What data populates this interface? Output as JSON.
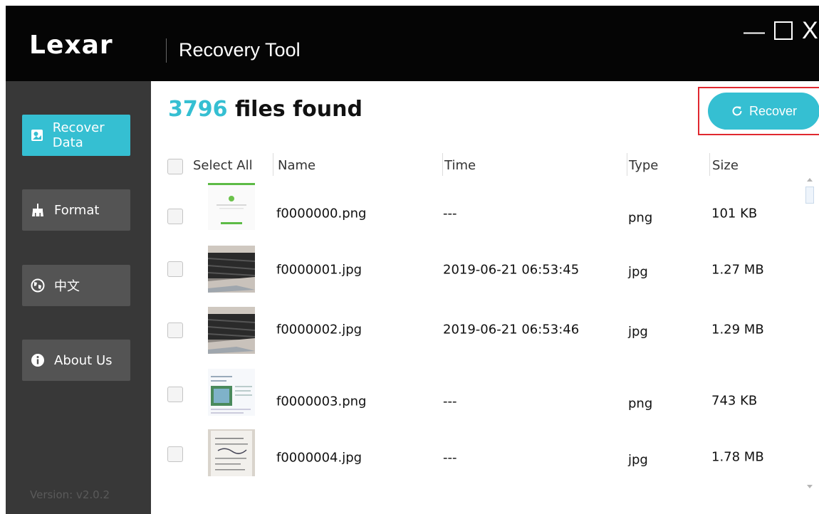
{
  "app": {
    "logo": "Lexar",
    "title": "Recovery Tool",
    "window_controls": [
      "—",
      "☐",
      "X"
    ]
  },
  "sidebar": {
    "items": [
      {
        "label": "Recover Data",
        "icon": "photo-icon",
        "active": true
      },
      {
        "label": "Format",
        "icon": "broom-icon",
        "active": false
      },
      {
        "label": "中文",
        "icon": "globe-icon",
        "active": false
      },
      {
        "label": "About Us",
        "icon": "info-icon",
        "active": false
      }
    ],
    "version": "Version: v2.0.2"
  },
  "main": {
    "count": "3796",
    "count_suffix": " files found",
    "recover_label": "Recover",
    "columns": {
      "select_all": "Select All",
      "name": "Name",
      "time": "Time",
      "type": "Type",
      "size": "Size"
    },
    "files": [
      {
        "name": "f0000000.png",
        "time": "---",
        "type": "png",
        "size": "101 KB",
        "thumb": "green-screenshot"
      },
      {
        "name": "f0000001.jpg",
        "time": "2019-06-21 06:53:45",
        "type": "jpg",
        "size": "1.27 MB",
        "thumb": "dark-photo"
      },
      {
        "name": "f0000002.jpg",
        "time": "2019-06-21 06:53:46",
        "type": "jpg",
        "size": "1.29 MB",
        "thumb": "dark-photo"
      },
      {
        "name": "f0000003.png",
        "time": "---",
        "type": "png",
        "size": "743 KB",
        "thumb": "document-page"
      },
      {
        "name": "f0000004.jpg",
        "time": "---",
        "type": "jpg",
        "size": "1.78 MB",
        "thumb": "paper-photo"
      }
    ]
  },
  "colors": {
    "accent": "#35bfd2",
    "highlight_border": "#e0282f",
    "titlebar": "#050505",
    "sidebar": "#383838"
  }
}
